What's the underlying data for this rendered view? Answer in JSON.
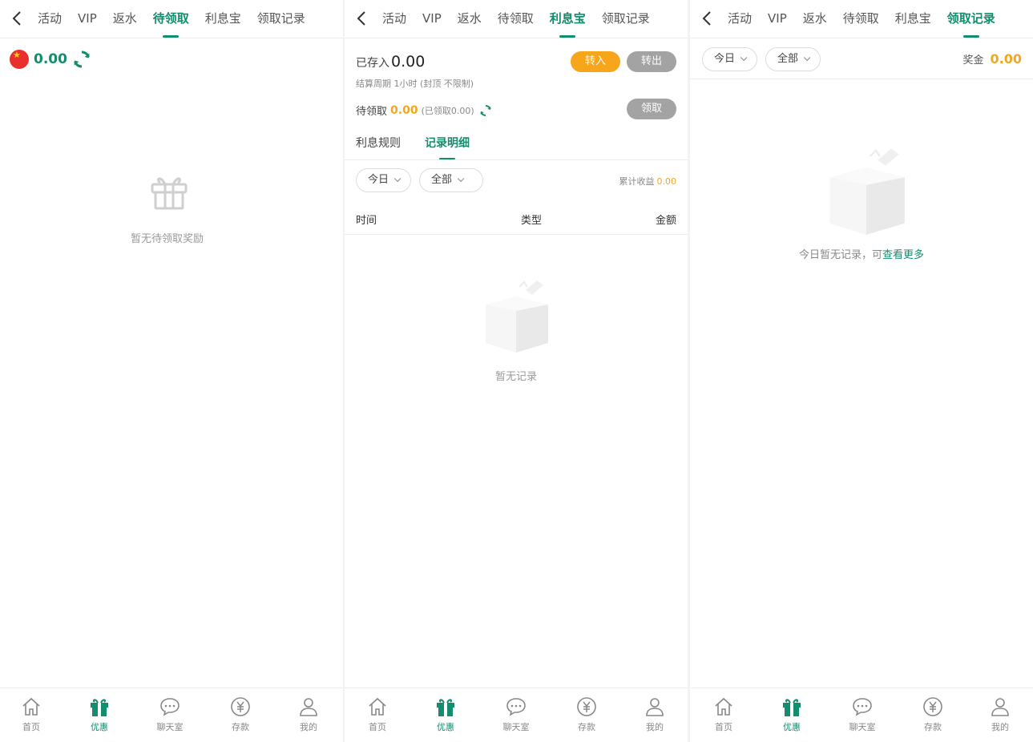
{
  "colors": {
    "accent": "#138d6e",
    "orange": "#f7a61c",
    "amount": "#f0a823",
    "grey_button": "#a3a3a3"
  },
  "panel1": {
    "tabs": [
      {
        "label": "活动"
      },
      {
        "label": "VIP"
      },
      {
        "label": "返水"
      },
      {
        "label": "待领取"
      },
      {
        "label": "利息宝"
      },
      {
        "label": "领取记录"
      }
    ],
    "active_tab": "待领取",
    "balance": "0.00",
    "empty_text": "暂无待领取奖励"
  },
  "panel2": {
    "tabs": [
      {
        "label": "活动"
      },
      {
        "label": "VIP"
      },
      {
        "label": "返水"
      },
      {
        "label": "待领取"
      },
      {
        "label": "利息宝"
      },
      {
        "label": "领取记录"
      }
    ],
    "active_tab": "利息宝",
    "saved_label": "已存入",
    "saved_value": "0.00",
    "transfer_in": "转入",
    "transfer_out": "转出",
    "cycle_text": "结算周期 1小时 (封顶 不限制)",
    "pending_label": "待领取",
    "pending_value": "0.00",
    "pending_claimed": "(已领取0.00)",
    "claim_button": "领取",
    "subtabs": [
      {
        "label": "利息规则"
      },
      {
        "label": "记录明细"
      }
    ],
    "active_subtab": "记录明细",
    "filter_date": "今日",
    "filter_type": "全部",
    "summary_label": "累计收益",
    "summary_value": "0.00",
    "table_headers": {
      "time": "时间",
      "type": "类型",
      "amount": "金额"
    },
    "empty_text": "暂无记录"
  },
  "panel3": {
    "tabs": [
      {
        "label": "活动"
      },
      {
        "label": "VIP"
      },
      {
        "label": "返水"
      },
      {
        "label": "待领取"
      },
      {
        "label": "利息宝"
      },
      {
        "label": "领取记录"
      }
    ],
    "active_tab": "领取记录",
    "filter_date": "今日",
    "filter_type": "全部",
    "prize_label": "奖金",
    "prize_value": "0.00",
    "empty_prefix": "今日暂无记录，可",
    "empty_link": "查看更多"
  },
  "bottom_nav": [
    {
      "label": "首页",
      "icon": "home-icon"
    },
    {
      "label": "优惠",
      "icon": "gift-icon",
      "active": true
    },
    {
      "label": "聊天室",
      "icon": "chat-icon"
    },
    {
      "label": "存款",
      "icon": "deposit-icon"
    },
    {
      "label": "我的",
      "icon": "user-icon"
    }
  ]
}
